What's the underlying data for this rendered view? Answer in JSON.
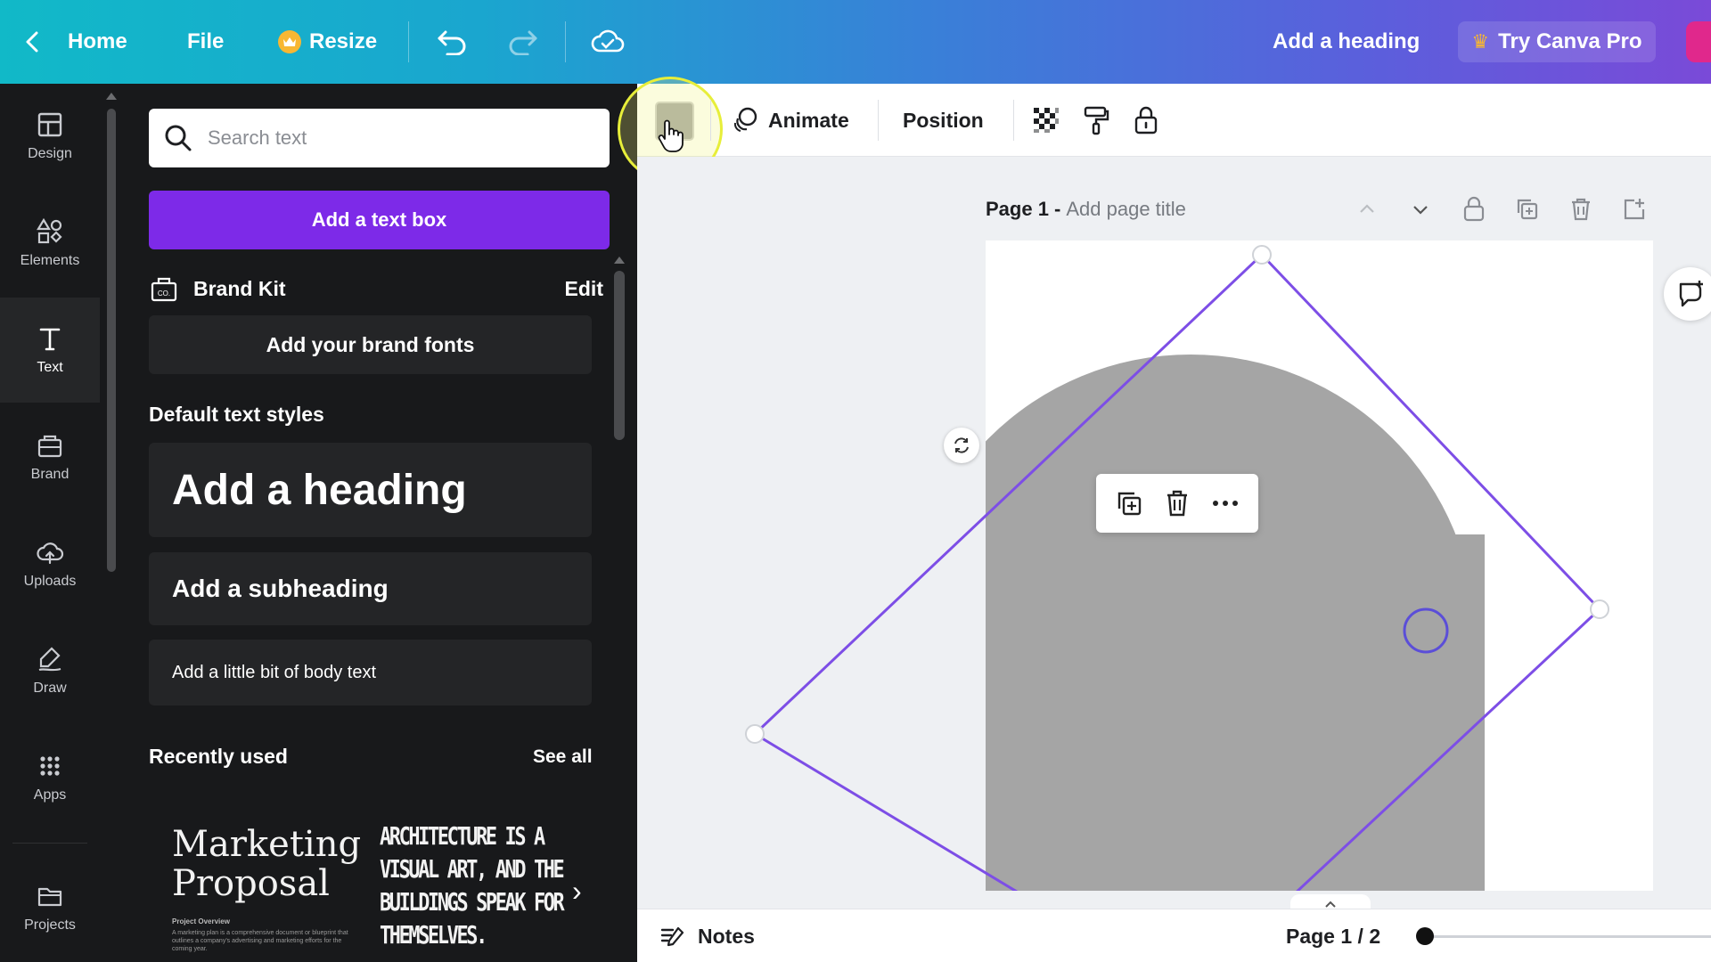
{
  "topbar": {
    "home_label": "Home",
    "file_label": "File",
    "resize_label": "Resize",
    "add_heading_label": "Add a heading",
    "try_pro_label": "Try Canva Pro",
    "brand_color": "#7d2ae8"
  },
  "rail": {
    "items": [
      {
        "label": "Design",
        "icon": "layout-icon"
      },
      {
        "label": "Elements",
        "icon": "shapes-icon"
      },
      {
        "label": "Text",
        "icon": "text-icon"
      },
      {
        "label": "Brand",
        "icon": "brand-kit-icon"
      },
      {
        "label": "Uploads",
        "icon": "cloud-upload-icon"
      },
      {
        "label": "Draw",
        "icon": "pen-icon"
      },
      {
        "label": "Apps",
        "icon": "grid-icon"
      },
      {
        "label": "Projects",
        "icon": "folder-icon"
      }
    ],
    "active": "Text"
  },
  "panel": {
    "search_placeholder": "Search text",
    "add_textbox_label": "Add a text box",
    "brand_kit_label": "Brand Kit",
    "brand_kit_edit": "Edit",
    "add_brand_fonts": "Add your brand fonts",
    "default_styles_title": "Default text styles",
    "heading_sample": "Add a heading",
    "subheading_sample": "Add a subheading",
    "body_sample": "Add a little bit of body text",
    "recently_used_title": "Recently used",
    "see_all": "See all",
    "recent": {
      "thumb1_title": "Marketing Proposal",
      "thumb1_sub": "Project Overview",
      "thumb1_body": "A marketing plan is a comprehensive document or blueprint that outlines a company's advertising and marketing efforts for the coming year.",
      "thumb2_text": "ARCHITECTURE IS A\nVISUAL ART, AND THE\nBUILDINGS SPEAK FOR\nTHEMSELVES."
    }
  },
  "context_toolbar": {
    "swatch_color": "#a8a8a8",
    "animate_label": "Animate",
    "position_label": "Position"
  },
  "canvas": {
    "page_label": "Page 1 -",
    "page_title_placeholder": "Add page title",
    "shape_color": "#a5a5a5",
    "selection_color": "#7d4ee6"
  },
  "bottombar": {
    "notes_label": "Notes",
    "page_count": "Page 1 / 2"
  }
}
